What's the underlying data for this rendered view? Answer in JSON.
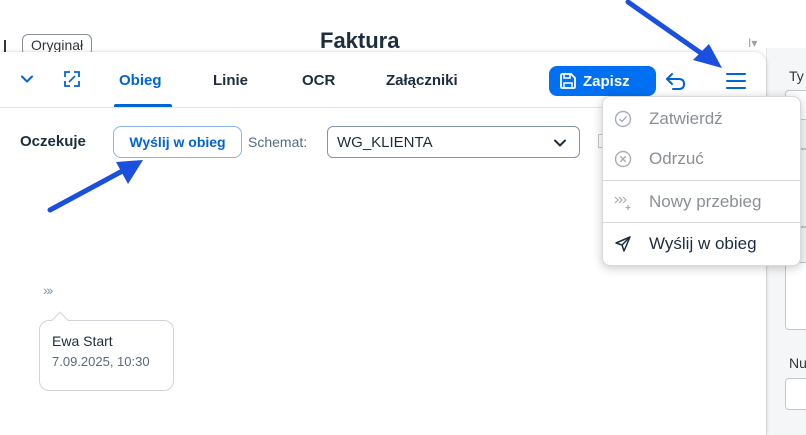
{
  "background": {
    "original_button": "Oryginał",
    "document_title": "Faktura",
    "right_panel_label_1": "Ty",
    "right_panel_label_2": "Nu"
  },
  "tabs": [
    {
      "label": "Obieg",
      "active": true
    },
    {
      "label": "Linie",
      "active": false
    },
    {
      "label": "OCR",
      "active": false
    },
    {
      "label": "Załączniki",
      "active": false
    }
  ],
  "toolbar": {
    "save_label": "Zapisz"
  },
  "workflow": {
    "status": "Oczekuje",
    "send_button": "Wyślij w obieg",
    "schema_label": "Schemat:",
    "schema_value": "WG_KLIENTA"
  },
  "timeline": {
    "steps_icon": "»›",
    "entries": [
      {
        "name": "Ewa Start",
        "date": "7.09.2025, 10:30"
      }
    ]
  },
  "menu": {
    "items": [
      {
        "label": "Zatwierdź",
        "icon": "check-circle-icon",
        "enabled": false
      },
      {
        "label": "Odrzuć",
        "icon": "cancel-circle-icon",
        "enabled": false
      },
      {
        "label": "Nowy przebieg",
        "icon": "new-step-icon",
        "enabled": false
      },
      {
        "label": "Wyślij w obieg",
        "icon": "send-icon",
        "enabled": true
      }
    ]
  },
  "colors": {
    "accent": "#0064d9",
    "primary_button": "#0070f2",
    "annotation_arrow": "#1a4fe0"
  }
}
